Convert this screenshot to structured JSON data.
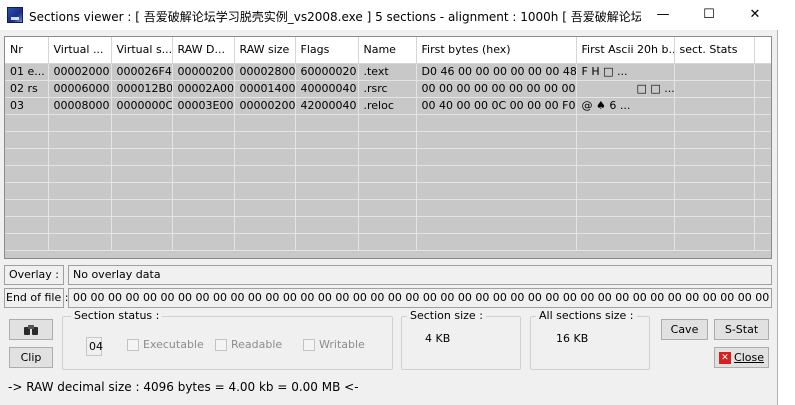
{
  "window": {
    "title": "Sections viewer : [ 吾爱破解论坛学习脱壳实例_vs2008.exe ] 5 sections - alignment : 1000h [ 吾爱破解论坛...",
    "minimize_glyph": "—",
    "maximize_glyph": "☐",
    "close_glyph": "✕"
  },
  "table": {
    "columns": [
      "Nr",
      "Virtual ...",
      "Virtual s...",
      "RAW D...",
      "RAW size",
      "Flags",
      "Name",
      "First bytes (hex)",
      "First Ascii 20h b...",
      "sect. Stats"
    ],
    "rows": [
      [
        "01 e...",
        "00002000",
        "000026F4",
        "00000200",
        "00002800",
        "60000020",
        ".text",
        "D0 46 00 00 00 00 00 00 48",
        "F   H   □ ...",
        ""
      ],
      [
        "02 rs",
        "00006000",
        "000012B0",
        "00002A00",
        "00001400",
        "40000040",
        ".rsrc",
        "00 00 00 00 00 00 00 00 00",
        "□ □ ...",
        ""
      ],
      [
        "03",
        "00008000",
        "0000000C",
        "00003E00",
        "00000200",
        "42000040",
        ".reloc",
        "00 40 00 00 0C 00 00 00 F0",
        "@  ♠   6      ...",
        ""
      ]
    ]
  },
  "overlay": {
    "label": "Overlay :",
    "value": "No overlay data"
  },
  "eof": {
    "label": "End of file :",
    "value": "00 00 00 00 00 00 00 00 00 00 00 00 00 00 00 00 00 00 00 00 00 00 00 00 00 00 00 00 00 00 00 00 00 00 00 00 00 00 00 00 00 00 00 00 00 00 00 00 00 00  |"
  },
  "section_status": {
    "title": "Section status :",
    "number": "04",
    "executable": "Executable",
    "readable": "Readable",
    "writable": "Writable"
  },
  "section_size": {
    "title": "Section size :",
    "value": "4 KB"
  },
  "all_sections_size": {
    "title": "All sections size :",
    "value": "16 KB"
  },
  "buttons": {
    "clip": "Clip",
    "cave": "Cave",
    "sstat": "S-Stat",
    "close": "Close"
  },
  "status_bar": "->  RAW decimal size :       4096 bytes   =     4.00 kb   =  0.00 MB  <-"
}
